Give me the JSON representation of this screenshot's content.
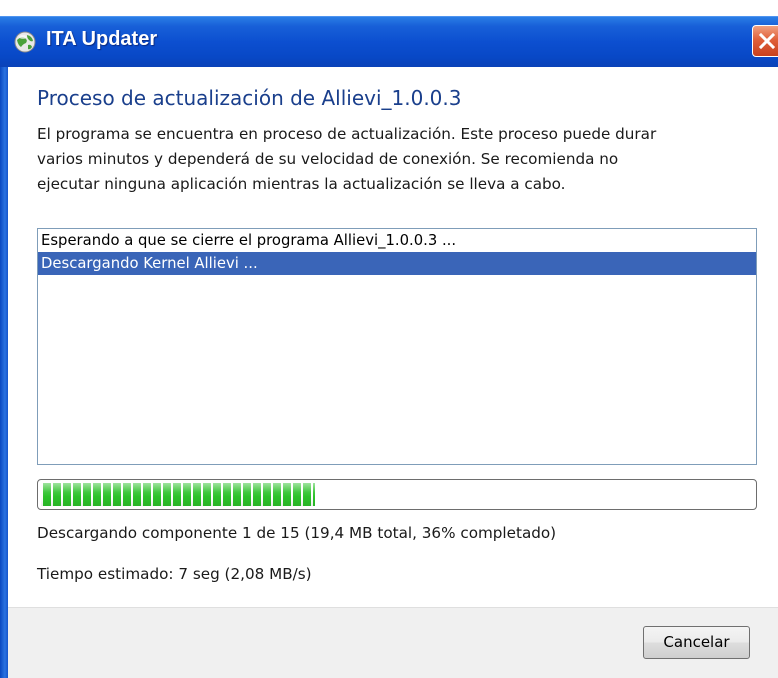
{
  "window": {
    "title": "ITA Updater"
  },
  "main": {
    "heading": "Proceso de actualización de Allievi_1.0.0.3",
    "description_lines": [
      "El programa se encuentra en proceso de actualización. Este proceso puede durar",
      "varios minutos y dependerá de su velocidad de conexión. Se recomienda no",
      "ejecutar ninguna aplicación mientras la actualización se lleva a cabo."
    ],
    "log": [
      {
        "text": "Esperando a que se cierre el programa Allievi_1.0.0.3 ...",
        "selected": false
      },
      {
        "text": "Descargando Kernel Allievi ...",
        "selected": true
      }
    ],
    "progress": {
      "value_percent": 36
    },
    "status_text": "Descargando componente 1 de 15 (19,4 MB total, 36% completado)",
    "time_text": "Tiempo estimado: 7 seg (2,08 MB/s)"
  },
  "footer": {
    "cancel_label": "Cancelar"
  },
  "colors": {
    "titlebar": "#0c4fd0",
    "heading": "#1a3f8c",
    "selection": "#3a65b8",
    "progress": "#2cc22a",
    "close": "#e0603a"
  },
  "icons": {
    "title_icon": "app-globe-icon",
    "close_icon": "close-icon"
  }
}
